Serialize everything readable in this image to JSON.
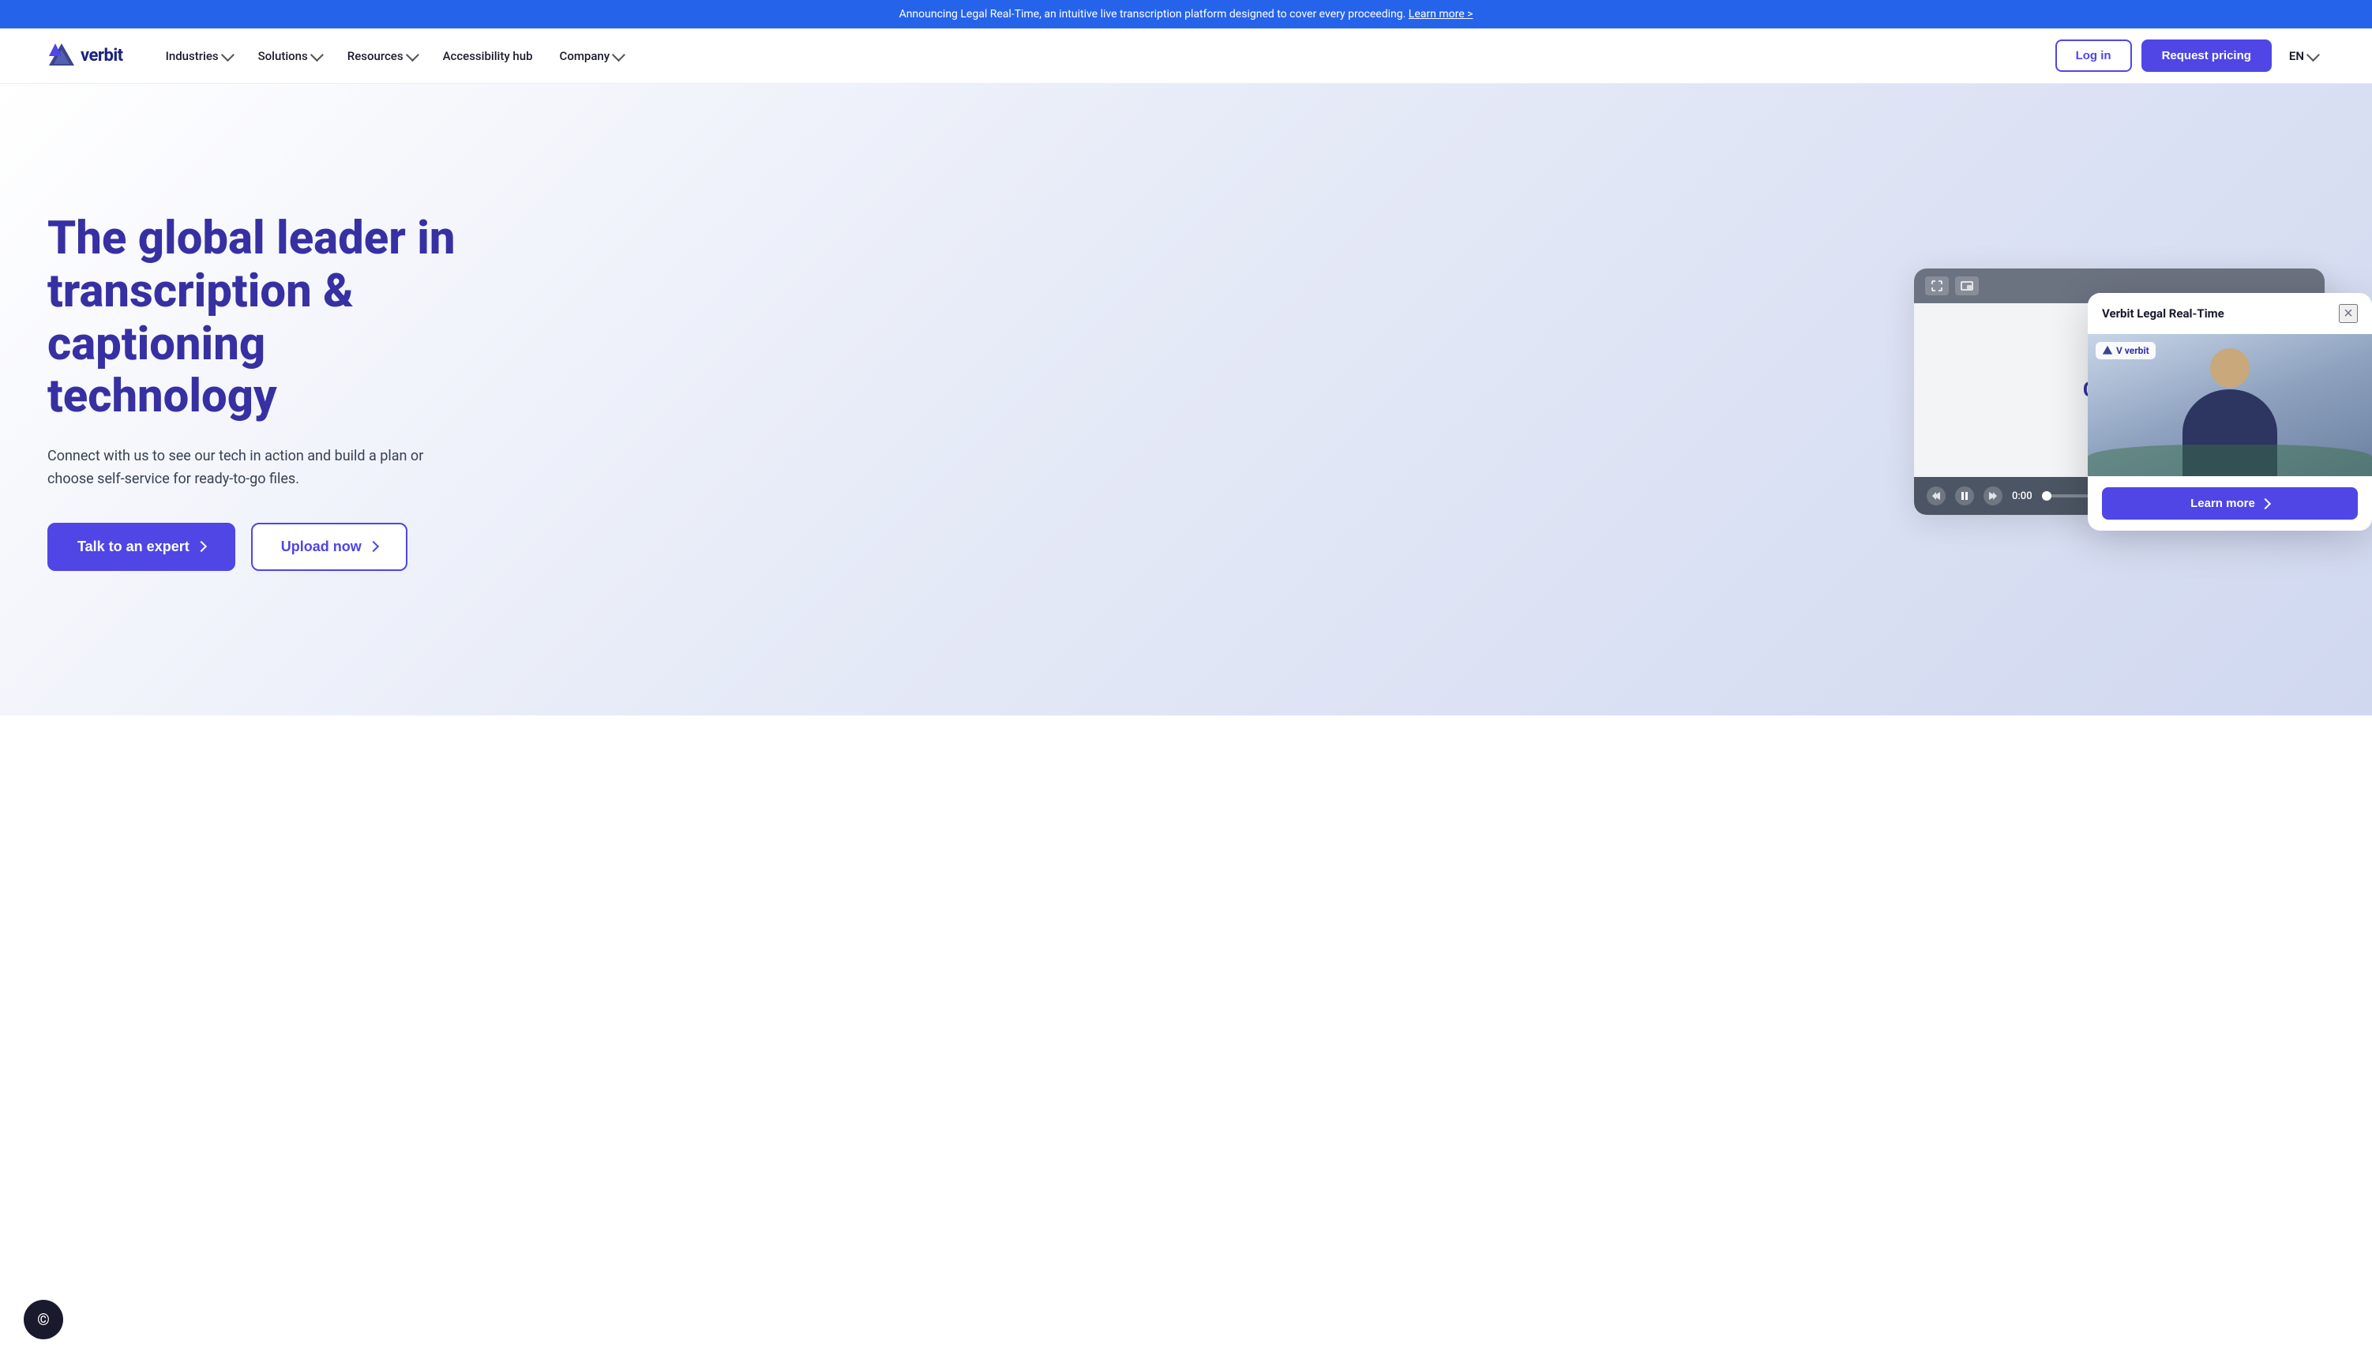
{
  "announcement": {
    "text": "Announcing Legal Real-Time, an intuitive live transcription platform designed to cover every proceeding.",
    "link_text": "Learn more >"
  },
  "header": {
    "logo_text": "verbit",
    "nav_items": [
      {
        "label": "Industries",
        "has_dropdown": true
      },
      {
        "label": "Solutions",
        "has_dropdown": true
      },
      {
        "label": "Resources",
        "has_dropdown": true
      },
      {
        "label": "Accessibility hub",
        "has_dropdown": false
      },
      {
        "label": "Company",
        "has_dropdown": true
      }
    ],
    "login_label": "Log in",
    "request_label": "Request pricing",
    "lang": "EN"
  },
  "hero": {
    "title_part1": "The global leader in",
    "title_part2": "transcription &",
    "title_part3": "captioning",
    "title_part4": "technology",
    "subtitle": "Connect with us to see our tech in action and build a plan or choose self-service for ready-to-go files.",
    "cta_talk": "Talk to an expert",
    "cta_upload": "Upload now",
    "video_capture_label": "Capture",
    "video_time": "0:00"
  },
  "popup": {
    "title": "Verbit Legal Real-Time",
    "close_label": "×",
    "logo_badge": "V verbit",
    "learn_more_label": "Learn more"
  },
  "colors": {
    "primary": "#4f46e5",
    "primary_dark": "#3730a3",
    "accent": "#6366f1",
    "announcement_bg": "#2563eb"
  }
}
